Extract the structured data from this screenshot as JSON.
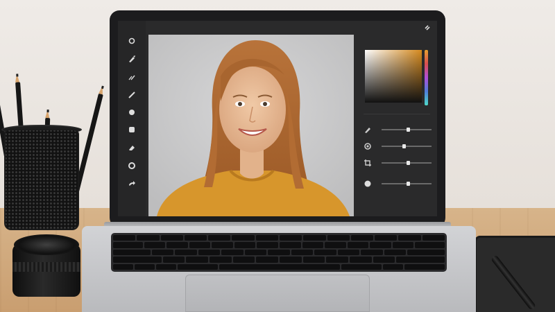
{
  "editor": {
    "toolbar_tools": [
      "target-icon",
      "pen-icon",
      "brush-icon",
      "pencil-icon",
      "circle-icon",
      "square-icon",
      "eraser-icon",
      "ring-icon",
      "redo-icon"
    ],
    "panel_sliders": [
      {
        "icon": "pen-icon",
        "value": 0.52
      },
      {
        "icon": "radio-icon",
        "value": 0.44
      },
      {
        "icon": "crop-icon",
        "value": 0.52
      },
      {
        "icon": "dot-icon",
        "value": 0.52
      }
    ],
    "colors": {
      "accent": "#d68a1e",
      "ui_dark": "#2a2a2b",
      "toolbar": "#262627"
    }
  },
  "keyboard": {
    "rows": [
      [
        "",
        "",
        "",
        "",
        "",
        "",
        "",
        "",
        "",
        "",
        "",
        "",
        "",
        ""
      ],
      [
        "",
        "",
        "",
        "",
        "",
        "",
        "",
        "",
        "",
        "",
        "",
        "",
        "",
        ""
      ],
      [
        "",
        "",
        "",
        "",
        "",
        "",
        "",
        "",
        "",
        "",
        "",
        "",
        ""
      ],
      [
        "",
        "",
        "",
        "",
        "",
        "",
        "",
        "",
        "",
        "",
        "",
        ""
      ],
      [
        "",
        "",
        "",
        "",
        "",
        "",
        "",
        ""
      ]
    ]
  }
}
